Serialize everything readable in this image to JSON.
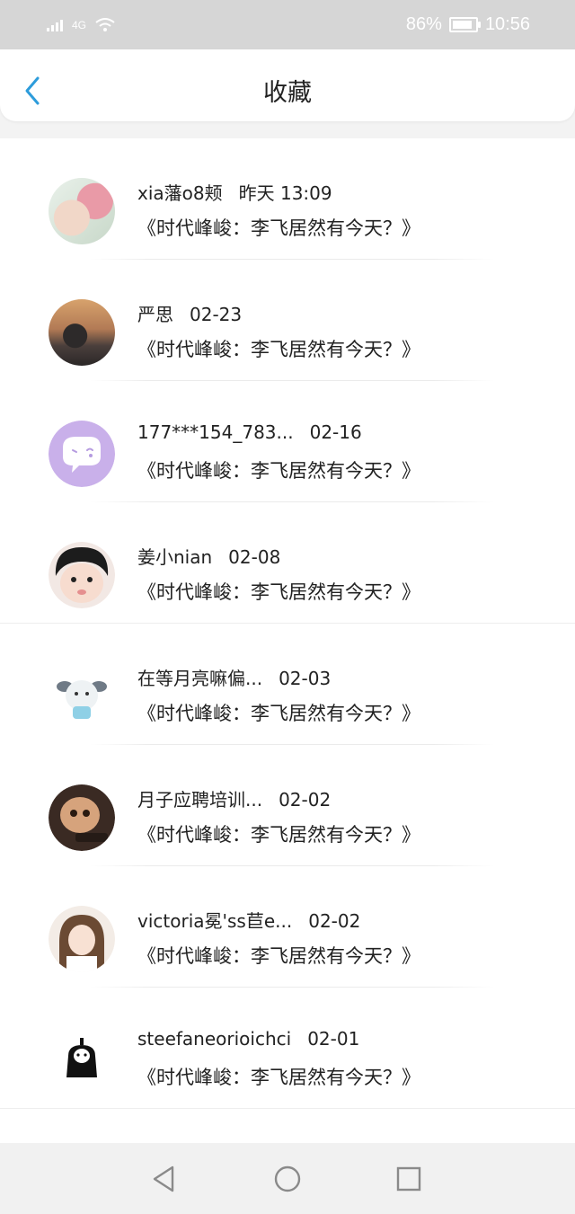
{
  "status_bar": {
    "network": "4G",
    "battery_percent": "86%",
    "battery_level": 0.86,
    "time": "10:56"
  },
  "header": {
    "back_icon": "chevron-left-icon",
    "title": "收藏",
    "accent_color": "#2d9cdb"
  },
  "favorites": [
    {
      "name": "xia藩o8颊",
      "time": "昨天 13:09",
      "subject": "《时代峰峻：李飞居然有今天？》"
    },
    {
      "name": "严思",
      "time": "02-23",
      "subject": "《时代峰峻：李飞居然有今天？》"
    },
    {
      "name": "177***154_783...",
      "time": "02-16",
      "subject": "《时代峰峻：李飞居然有今天？》"
    },
    {
      "name": "姜小nian",
      "time": "02-08",
      "subject": "《时代峰峻：李飞居然有今天？》"
    },
    {
      "name": "在等月亮嘛偏...",
      "time": "02-03",
      "subject": "《时代峰峻：李飞居然有今天？》"
    },
    {
      "name": "月子应聘培训...",
      "time": "02-02",
      "subject": "《时代峰峻：李飞居然有今天？》"
    },
    {
      "name": "victoria冕'ss苣e...",
      "time": "02-02",
      "subject": "《时代峰峻：李飞居然有今天？》"
    },
    {
      "name": "steefaneorioichci",
      "time": "02-01",
      "subject": "《时代峰峻：李飞居然有今天？》"
    }
  ],
  "nav_bar": {
    "back": "triangle-back-icon",
    "home": "circle-home-icon",
    "recents": "square-recents-icon"
  }
}
